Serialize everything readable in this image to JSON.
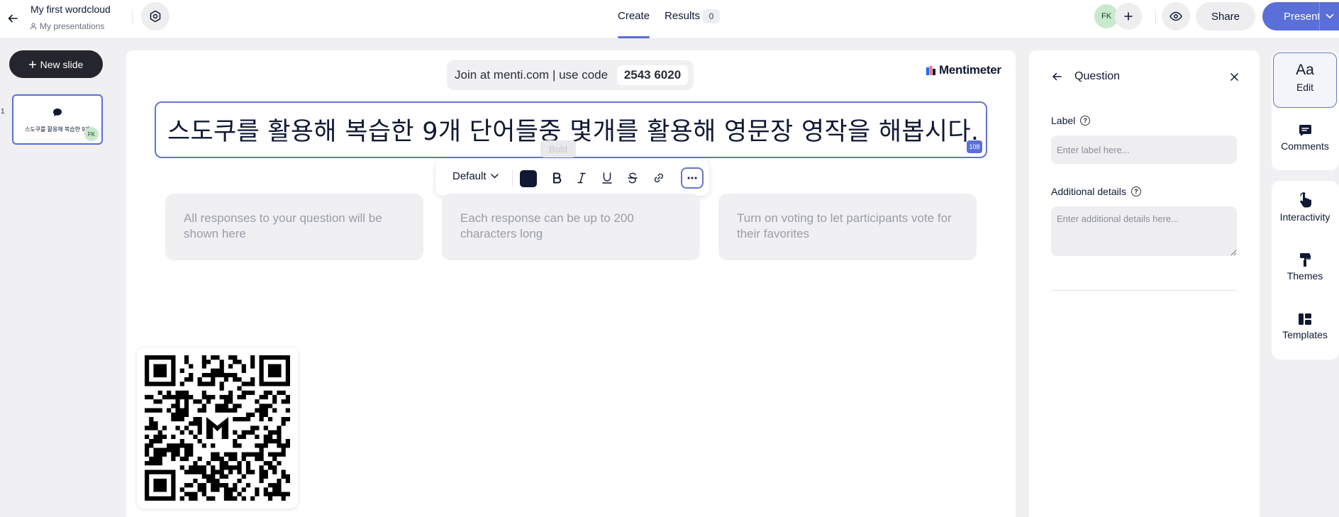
{
  "header": {
    "title": "My first wordcloud",
    "breadcrumb": "My presentations",
    "tabs": [
      {
        "label": "Create"
      },
      {
        "label": "Results",
        "count": "0"
      }
    ],
    "avatar_initials": "FK",
    "share_label": "Share",
    "present_label": "Present"
  },
  "sidebar": {
    "new_slide_label": "New slide",
    "slide_number": "1",
    "thumb_text": "스도쿠를 활용해 복습한 9개",
    "thumb_initials": "FK"
  },
  "slide": {
    "join_text": "Join at menti.com | use code",
    "join_code": "2543 6020",
    "brand": "Mentimeter",
    "question": "스도쿠를 활용해 복습한 9개 단어들중 몇개를 활용해 영문장 영작을 해봅시다.",
    "char_count": "108",
    "tooltip": "Bold",
    "font_select": "Default",
    "info_cards": [
      "All responses to your question will be shown here",
      "Each response can be up to 200 characters long",
      "Turn on voting to let participants vote for their favorites"
    ]
  },
  "panel": {
    "title": "Question",
    "label_title": "Label",
    "label_placeholder": "Enter label here...",
    "details_title": "Additional details",
    "details_placeholder": "Enter additional details here..."
  },
  "rail": {
    "items": [
      "Edit",
      "Comments",
      "Interactivity",
      "Themes",
      "Templates"
    ],
    "edit_glyph": "Aa"
  },
  "colors": {
    "accent": "#5a6fd8",
    "dark_button": "#24252d"
  }
}
